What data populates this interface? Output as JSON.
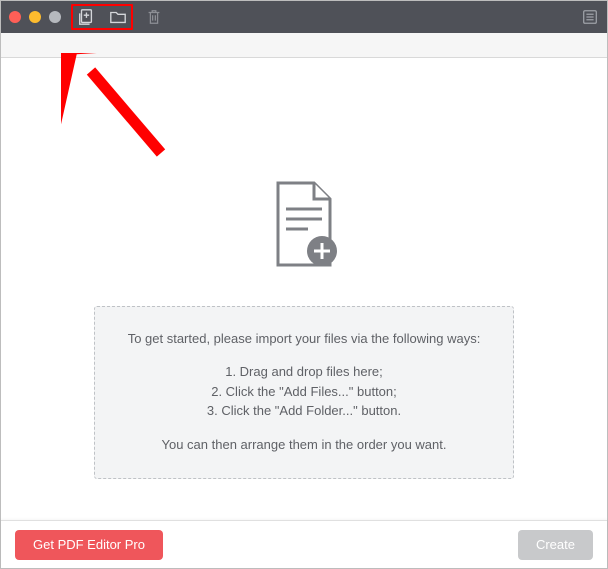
{
  "instructions": {
    "lead": "To get started, please import your files via the following ways:",
    "line1": "1. Drag and drop files here;",
    "line2": "2. Click the \"Add Files...\" button;",
    "line3": "3. Click the \"Add Folder...\" button.",
    "trail": "You can then arrange them in the order you want."
  },
  "footer": {
    "promo_label": "Get PDF Editor Pro",
    "create_label": "Create"
  }
}
